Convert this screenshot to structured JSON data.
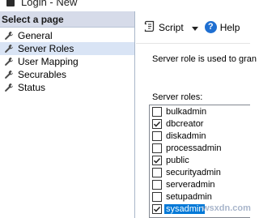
{
  "window": {
    "title": "Login - New"
  },
  "left_pane": {
    "header": "Select a page",
    "items": [
      {
        "label": "General",
        "icon": "wrench-icon",
        "selected": false
      },
      {
        "label": "Server Roles",
        "icon": "wrench-icon",
        "selected": true
      },
      {
        "label": "User Mapping",
        "icon": "wrench-icon",
        "selected": false
      },
      {
        "label": "Securables",
        "icon": "wrench-icon",
        "selected": false
      },
      {
        "label": "Status",
        "icon": "wrench-icon",
        "selected": false
      }
    ]
  },
  "toolbar": {
    "script_label": "Script",
    "help_label": "Help"
  },
  "main": {
    "description": "Server role is used to gran",
    "roles_label": "Server roles:",
    "roles": [
      {
        "name": "bulkadmin",
        "checked": false
      },
      {
        "name": "dbcreator",
        "checked": true
      },
      {
        "name": "diskadmin",
        "checked": false
      },
      {
        "name": "processadmin",
        "checked": false
      },
      {
        "name": "public",
        "checked": true
      },
      {
        "name": "securityadmin",
        "checked": false
      },
      {
        "name": "serveradmin",
        "checked": false
      },
      {
        "name": "setupadmin",
        "checked": false
      },
      {
        "name": "sysadmin",
        "checked": true
      }
    ]
  },
  "watermark": "wsxdn.com",
  "colors": {
    "selection": "#0078d7",
    "header_bg": "#d6dbe9",
    "help_blue": "#1f6fd1"
  }
}
